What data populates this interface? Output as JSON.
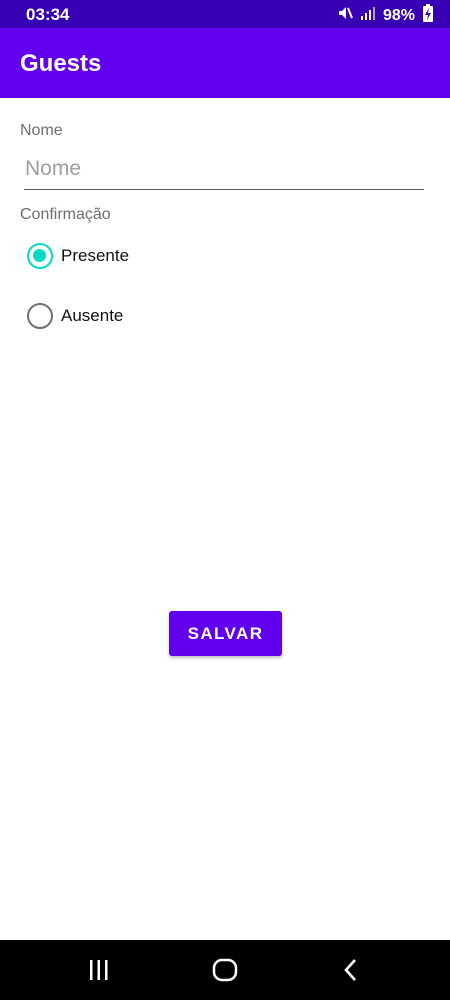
{
  "status_bar": {
    "time": "03:34",
    "battery": "98%",
    "icons": [
      "mute-icon",
      "signal-icon",
      "battery-icon"
    ]
  },
  "app_bar": {
    "title": "Guests",
    "color": "#6200ee"
  },
  "form": {
    "name_label": "Nome",
    "name_placeholder": "Nome",
    "name_value": "",
    "confirmation_label": "Confirmação",
    "options": [
      {
        "label": "Presente",
        "checked": true
      },
      {
        "label": "Ausente",
        "checked": false
      }
    ],
    "accent_color": "#03dac5"
  },
  "save_button": {
    "label": "SALVAR"
  },
  "nav_bar": {
    "icons": [
      "recents-icon",
      "home-icon",
      "back-icon"
    ]
  }
}
